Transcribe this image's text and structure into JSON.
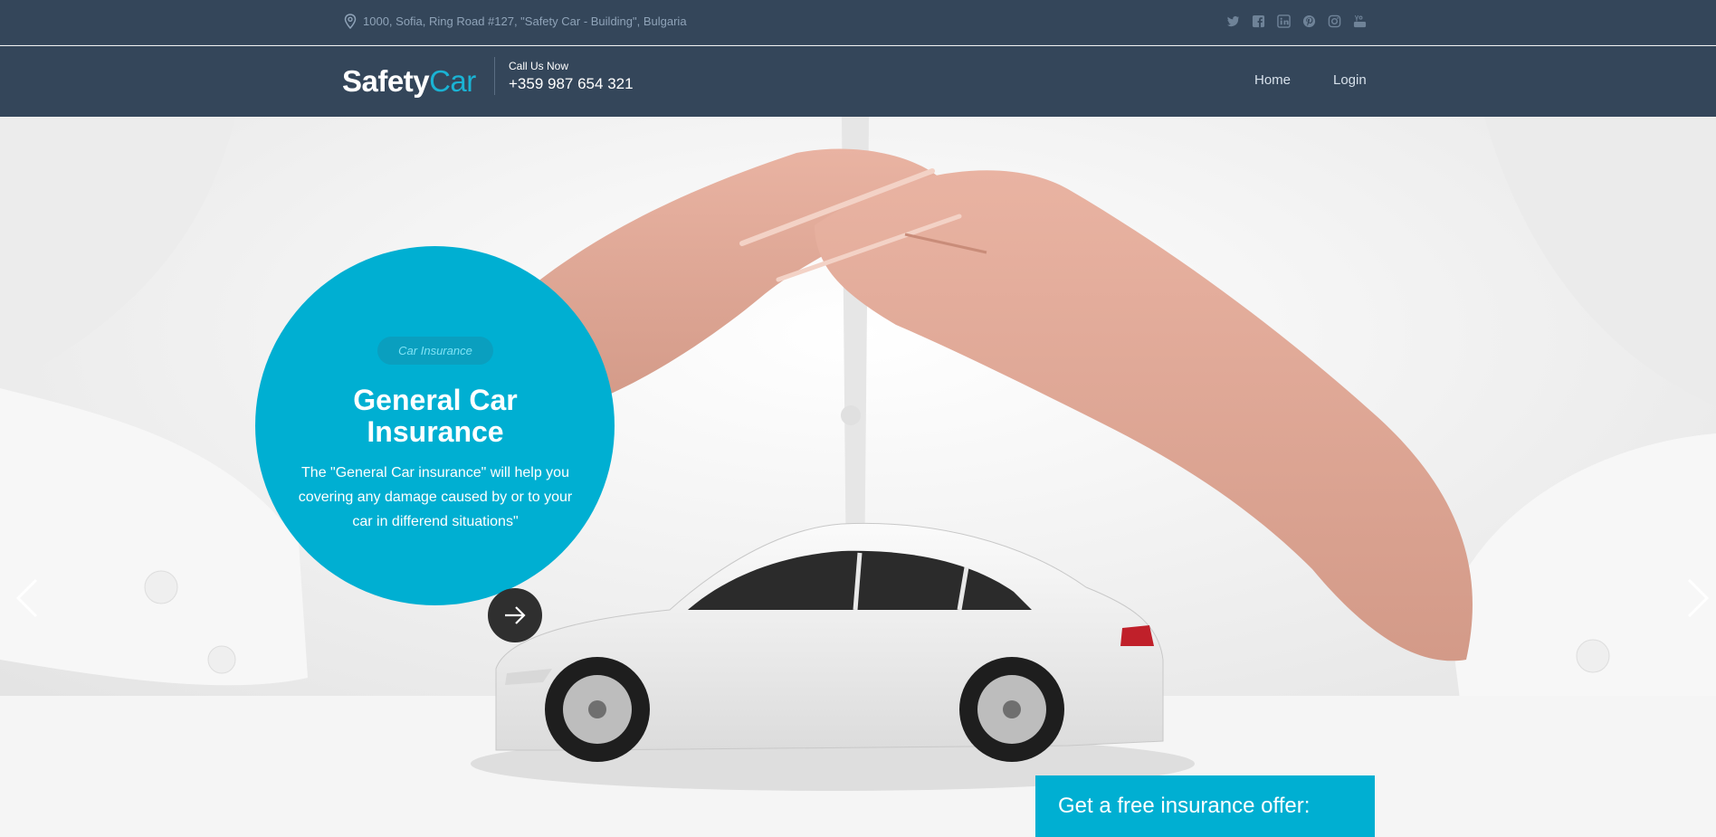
{
  "topbar": {
    "address": "1000, Sofia, Ring Road #127, \"Safety Car - Building\", Bulgaria",
    "socials": [
      "twitter-icon",
      "facebook-icon",
      "linkedin-icon",
      "pinterest-icon",
      "instagram-icon",
      "youtube-icon"
    ]
  },
  "header": {
    "logo_part1": "Safety",
    "logo_part2": "Car",
    "call_label": "Call Us Now",
    "phone": "+359 987 654 321",
    "nav": {
      "home": "Home",
      "login": "Login"
    }
  },
  "hero": {
    "tag": "Car Insurance",
    "title": "General Car Insurance",
    "description": "The \"General Car insurance\" will help you covering any damage caused by or to your car in differend situations\"",
    "offer_label": "Get a free insurance offer:"
  },
  "colors": {
    "header_bg": "#34465a",
    "accent": "#00afd2",
    "button_dark": "#2f2f2f"
  }
}
